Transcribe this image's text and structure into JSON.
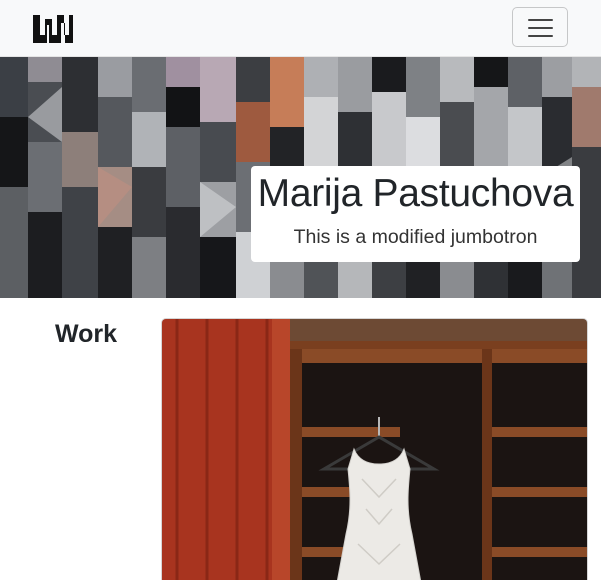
{
  "navbar": {
    "brand_icon": "wave-logo-icon",
    "toggler_icon": "hamburger-menu-icon"
  },
  "jumbotron": {
    "title": "Marija Pastuchova",
    "subtitle": "This is a modified jumbotron"
  },
  "work": {
    "title": "Work",
    "image_subject": "white-dress-on-hanger"
  },
  "colors": {
    "navbar_bg": "#f8f9fa",
    "wardrobe_red": "#a8341f",
    "wood_brown": "#7a3f1f"
  }
}
